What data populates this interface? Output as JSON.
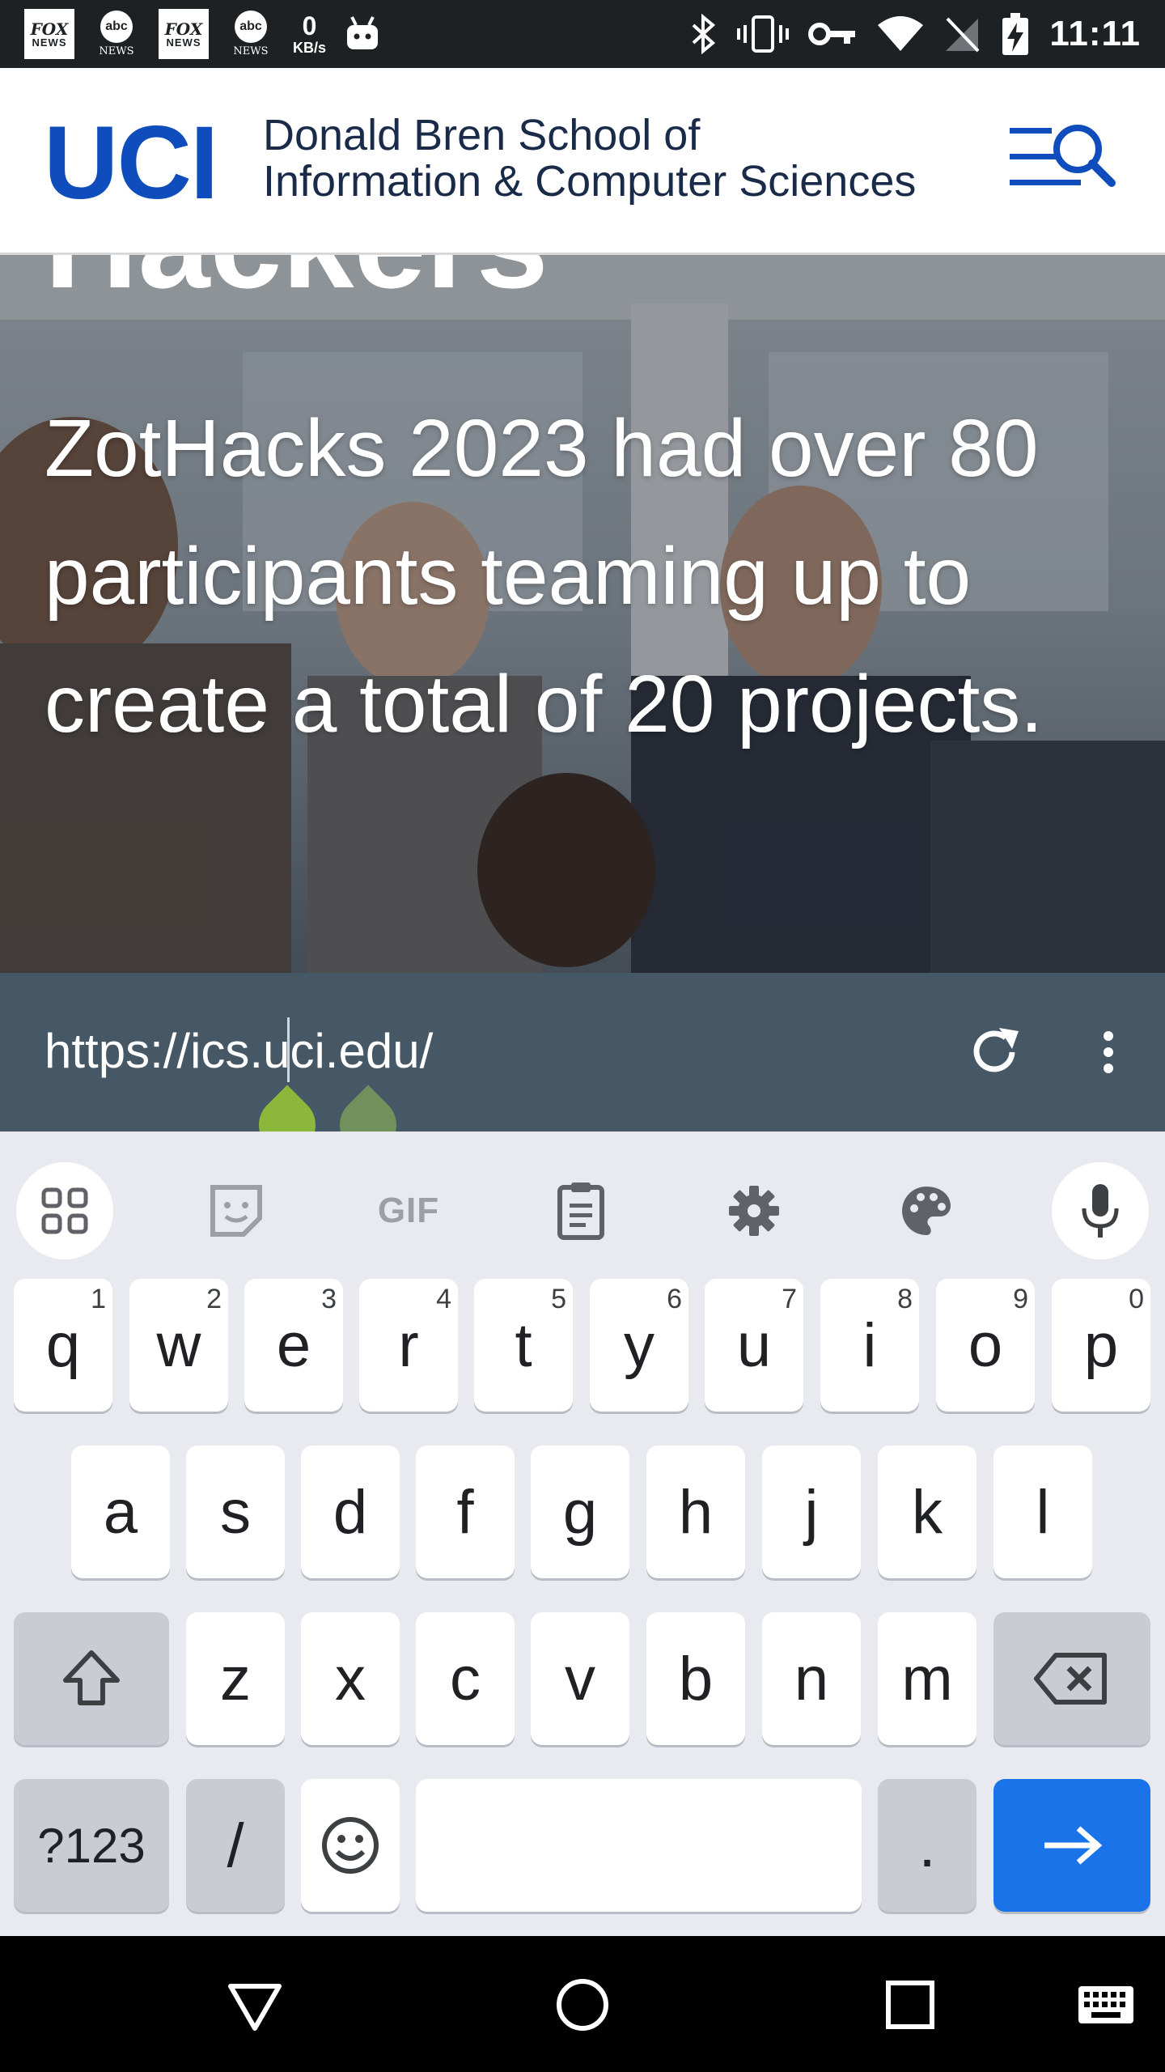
{
  "status_bar": {
    "notifications": [
      {
        "type": "fox",
        "line1": "FOX",
        "line2": "NEWS"
      },
      {
        "type": "abc",
        "line1": "abc",
        "line2": "NEWS"
      },
      {
        "type": "fox",
        "line1": "FOX",
        "line2": "NEWS"
      },
      {
        "type": "abc",
        "line1": "abc",
        "line2": "NEWS"
      }
    ],
    "speed_value": "0",
    "speed_unit": "KB/s",
    "time": "11:11",
    "icons": [
      "bluetooth-icon",
      "vibrate-icon",
      "vpn-key-icon",
      "wifi-icon",
      "no-signal-icon",
      "battery-charging-icon"
    ]
  },
  "header": {
    "logo": "UCI",
    "school_line1": "Donald Bren School of",
    "school_line2": "Information & Computer Sciences",
    "menu_icon": "menu-search-icon",
    "brand_color": "#0f4dbc"
  },
  "hero": {
    "title_fragment": "Hackers",
    "text": "ZotHacks 2023 had over 80 participants teaming up to create a total of 20 projects."
  },
  "browser": {
    "url": "https://ics.uci.edu/",
    "reload_icon": "reload-icon",
    "menu_icon": "more-vert-icon",
    "handle_color": "#8bb83b"
  },
  "keyboard": {
    "toolbar": {
      "apps_icon": "apps-grid-icon",
      "sticker_icon": "sticker-icon",
      "gif_label": "GIF",
      "clipboard_icon": "clipboard-icon",
      "settings_icon": "gear-icon",
      "theme_icon": "palette-icon",
      "mic_icon": "microphone-icon"
    },
    "row1": [
      {
        "key": "q",
        "num": "1"
      },
      {
        "key": "w",
        "num": "2"
      },
      {
        "key": "e",
        "num": "3"
      },
      {
        "key": "r",
        "num": "4"
      },
      {
        "key": "t",
        "num": "5"
      },
      {
        "key": "y",
        "num": "6"
      },
      {
        "key": "u",
        "num": "7"
      },
      {
        "key": "i",
        "num": "8"
      },
      {
        "key": "o",
        "num": "9"
      },
      {
        "key": "p",
        "num": "0"
      }
    ],
    "row2": [
      "a",
      "s",
      "d",
      "f",
      "g",
      "h",
      "j",
      "k",
      "l"
    ],
    "row3": [
      "z",
      "x",
      "c",
      "v",
      "b",
      "n",
      "m"
    ],
    "symbols_label": "?123",
    "slash_label": "/",
    "period_label": ".",
    "accent_color": "#1a73e8"
  },
  "nav_bar": {
    "back_icon": "back-triangle-icon",
    "home_icon": "home-circle-icon",
    "recents_icon": "recents-square-icon",
    "keyboard_icon": "keyboard-icon"
  }
}
